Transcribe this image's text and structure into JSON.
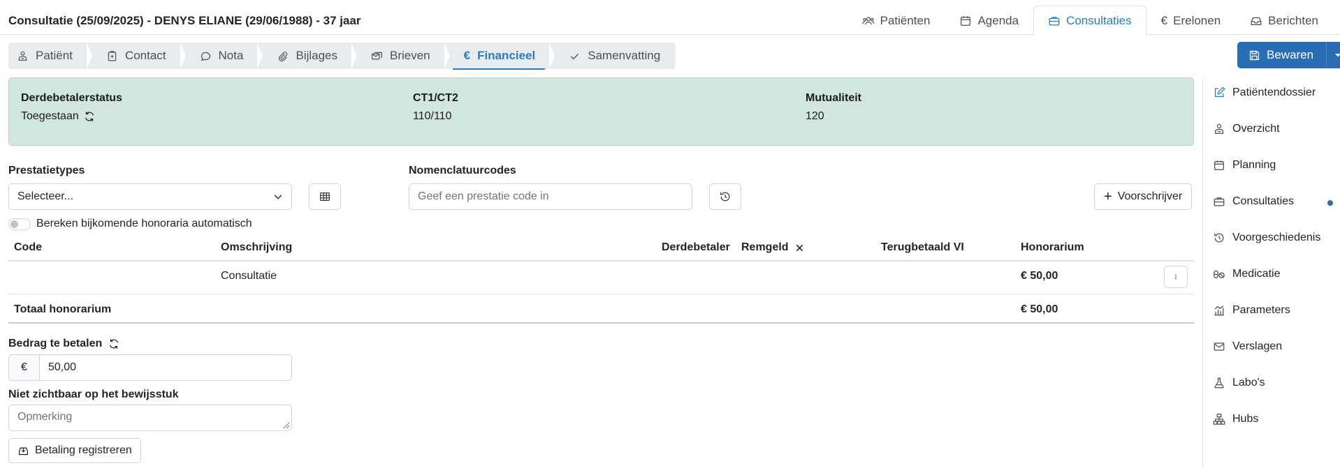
{
  "header": {
    "title": "Consultatie (25/09/2025) - DENYS ELIANE (29/06/1988) - 37 jaar",
    "nav": [
      {
        "label": "Patiënten",
        "icon": "users-icon"
      },
      {
        "label": "Agenda",
        "icon": "calendar-icon"
      },
      {
        "label": "Consultaties",
        "icon": "briefcase-icon",
        "active": true
      },
      {
        "label": "Erelonen",
        "icon": "euro-icon"
      },
      {
        "label": "Berichten",
        "icon": "inbox-icon"
      }
    ]
  },
  "steps": [
    {
      "label": "Patiënt",
      "icon": "patient-icon"
    },
    {
      "label": "Contact",
      "icon": "clipboard-plus-icon"
    },
    {
      "label": "Nota",
      "icon": "chat-icon"
    },
    {
      "label": "Bijlages",
      "icon": "paperclip-icon"
    },
    {
      "label": "Brieven",
      "icon": "letters-icon"
    },
    {
      "label": "Financieel",
      "icon": "euro-icon",
      "active": true
    },
    {
      "label": "Samenvatting",
      "icon": "check-icon"
    }
  ],
  "toolbar": {
    "save_label": "Bewaren"
  },
  "status": {
    "derdebetaler_label": "Derdebetalerstatus",
    "derdebetaler_value": "Toegestaan",
    "ct_label": "CT1/CT2",
    "ct_value": "110/110",
    "mutualiteit_label": "Mutualiteit",
    "mutualiteit_value": "120",
    "background_color": "#d1e7dd"
  },
  "form": {
    "prestatietypes_label": "Prestatietypes",
    "prestatietypes_value": "Selecteer...",
    "nomenclatuur_label": "Nomenclatuurcodes",
    "nomenclatuur_placeholder": "Geef een prestatie code in",
    "voorschrijver_label": "Voorschrijver",
    "auto_toggle_label": "Bereken bijkomende honoraria automatisch"
  },
  "table": {
    "headers": {
      "code": "Code",
      "omschrijving": "Omschrijving",
      "derdebetaler": "Derdebetaler",
      "remgeld": "Remgeld",
      "terugbetaald": "Terugbetaald VI",
      "honorarium": "Honorarium"
    },
    "rows": [
      {
        "code": "",
        "omschrijving": "Consultatie",
        "honorarium": "€ 50,00"
      }
    ],
    "total_label": "Totaal honorarium",
    "total_value": "€ 50,00"
  },
  "payment": {
    "amount_label": "Bedrag te betalen",
    "currency": "€",
    "amount_value": "50,00",
    "note_label": "Niet zichtbaar op het bewijsstuk",
    "note_placeholder": "Opmerking",
    "register_label": "Betaling registreren"
  },
  "sidebar": {
    "items": [
      {
        "label": "Patiëntendossier",
        "icon": "external-edit-icon"
      },
      {
        "label": "Overzicht",
        "icon": "patient-icon"
      },
      {
        "label": "Planning",
        "icon": "calendar-icon"
      },
      {
        "label": "Consultaties",
        "icon": "briefcase-icon",
        "indicator": true
      },
      {
        "label": "Voorgeschiedenis",
        "icon": "history-icon"
      },
      {
        "label": "Medicatie",
        "icon": "pills-icon"
      },
      {
        "label": "Parameters",
        "icon": "chart-icon"
      },
      {
        "label": "Verslagen",
        "icon": "envelope-icon"
      },
      {
        "label": "Labo's",
        "icon": "flask-icon"
      },
      {
        "label": "Hubs",
        "icon": "network-icon"
      }
    ]
  },
  "colors": {
    "accent": "#2b7bbd",
    "primary_button": "#2b6db4"
  }
}
